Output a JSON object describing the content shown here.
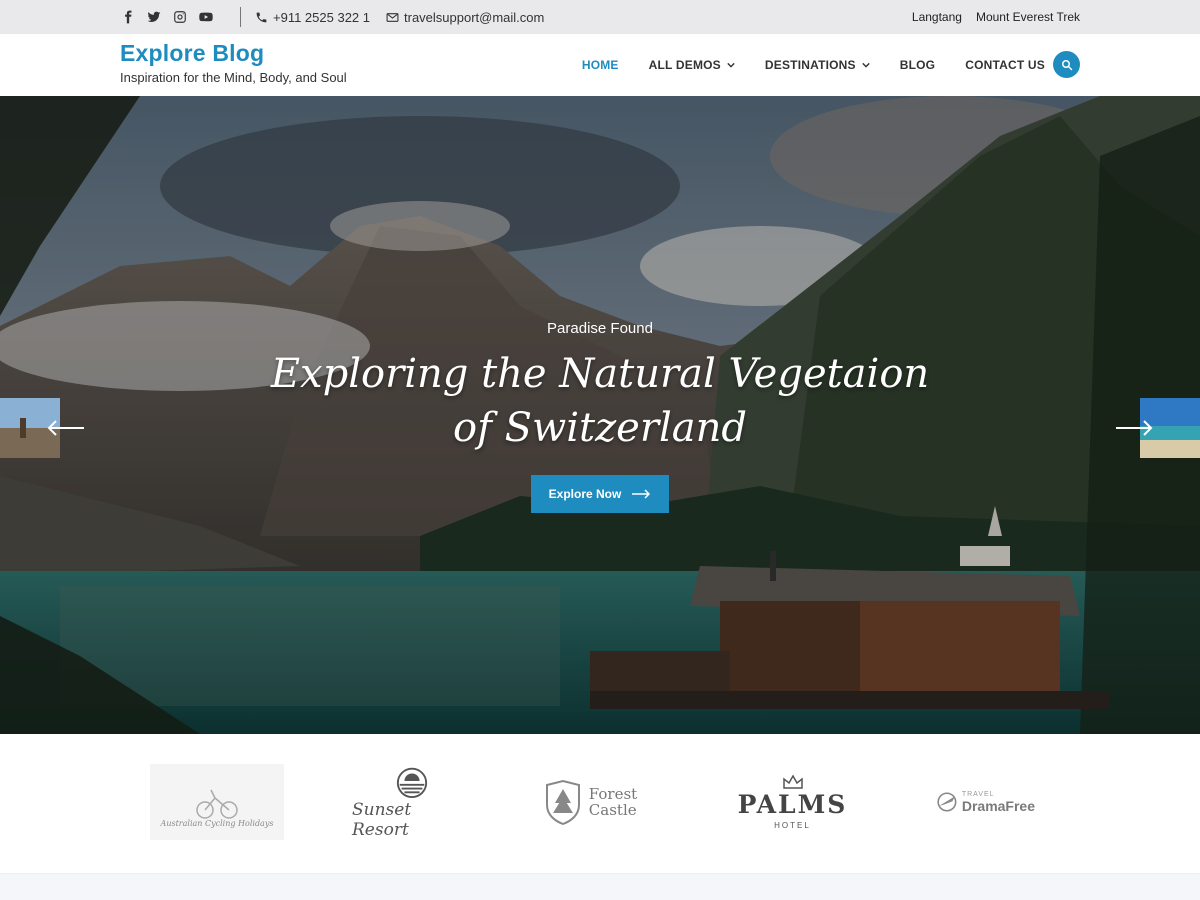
{
  "topbar": {
    "social_icons": [
      "facebook-icon",
      "twitter-icon",
      "instagram-icon",
      "youtube-icon"
    ],
    "phone": "+911 2525 322 1",
    "email": "travelsupport@mail.com",
    "links": [
      "Langtang",
      "Mount Everest Trek"
    ]
  },
  "header": {
    "site_title": "Explore Blog",
    "tagline": "Inspiration for the Mind, Body, and Soul",
    "nav": [
      {
        "label": "HOME",
        "active": true,
        "dropdown": false
      },
      {
        "label": "ALL DEMOS",
        "active": false,
        "dropdown": true
      },
      {
        "label": "DESTINATIONS",
        "active": false,
        "dropdown": true
      },
      {
        "label": "BLOG",
        "active": false,
        "dropdown": false
      },
      {
        "label": "CONTACT US",
        "active": false,
        "dropdown": false
      }
    ],
    "search_icon": "search-icon"
  },
  "hero": {
    "subtitle": "Paradise Found",
    "title_line1": "Exploring the Natural Vegetaion",
    "title_line2": "of Switzerland",
    "button_label": "Explore Now",
    "prev_icon": "arrow-left-icon",
    "next_icon": "arrow-right-icon"
  },
  "logos": {
    "logo1": "Australian Cycling Holidays",
    "logo2": "Sunset Resort",
    "logo3_line1": "Forest",
    "logo3_line2": "Castle",
    "logo4_main": "PALMS",
    "logo4_sub": "HOTEL",
    "logo5_small": "TRAVEL",
    "logo5_main": "DramaFree"
  },
  "colors": {
    "accent": "#1e8cbe",
    "topbar_bg": "#e9e9eb"
  }
}
